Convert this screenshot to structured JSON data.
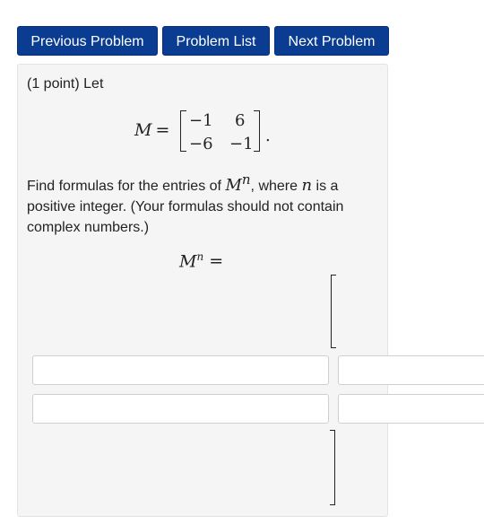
{
  "nav": {
    "prev_label": "Previous Problem",
    "list_label": "Problem List",
    "next_label": "Next Problem"
  },
  "problem": {
    "intro": "(1 point) Let",
    "matrix_name": "M",
    "equals": "=",
    "matrix": [
      [
        "−1",
        "6"
      ],
      [
        "−6",
        "−1"
      ]
    ],
    "period": ".",
    "find_text_1": "Find formulas for the entries of ",
    "find_math_base": "M",
    "find_math_exp": "n",
    "find_text_2": ", where ",
    "find_math_n": "n",
    "find_text_3": " is a positive integer. (Your formulas should not contain complex numbers.)",
    "answer_lhs_base": "M",
    "answer_lhs_exp": "n",
    "answer_lhs_eq": "=",
    "answers": [
      [
        "",
        ""
      ],
      [
        "",
        ""
      ]
    ]
  }
}
